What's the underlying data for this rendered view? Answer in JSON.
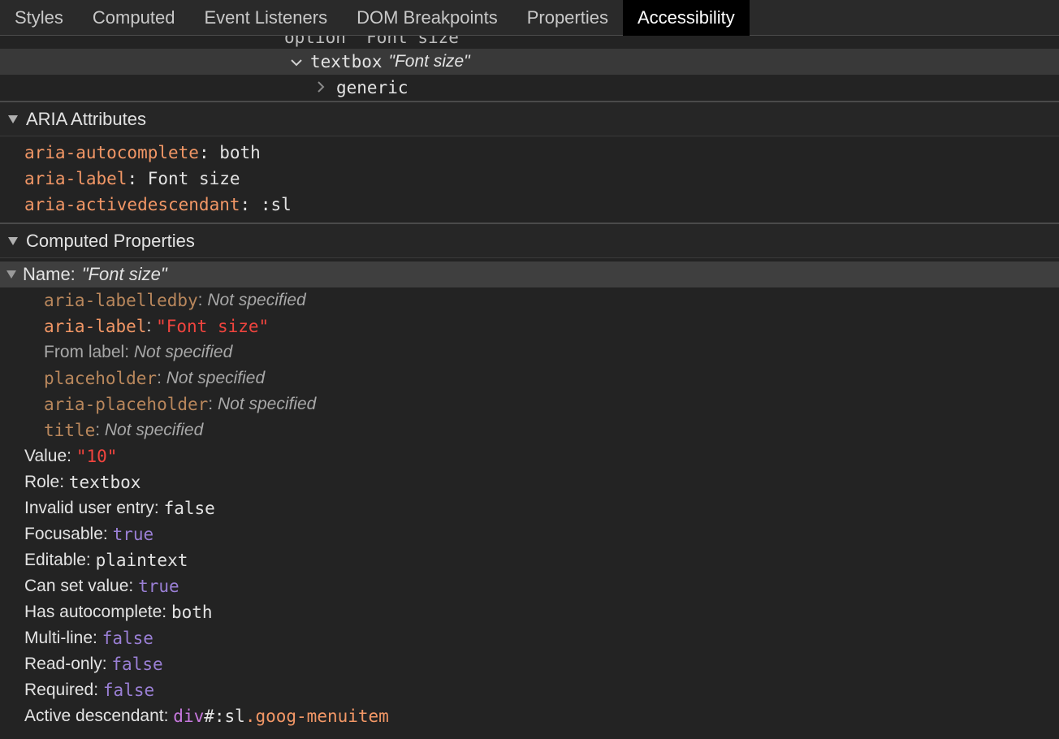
{
  "tabs": [
    "Styles",
    "Computed",
    "Event Listeners",
    "DOM Breakpoints",
    "Properties",
    "Accessibility"
  ],
  "tree": {
    "clipped_row": "option \"Font size\"",
    "selected": {
      "role": "textbox",
      "name": "\"Font size\""
    },
    "child": "generic"
  },
  "aria_section": {
    "title": "ARIA Attributes",
    "attrs": [
      {
        "name": "aria-autocomplete",
        "value": "both"
      },
      {
        "name": "aria-label",
        "value": "Font size"
      },
      {
        "name": "aria-activedescendant",
        "value": ":sl"
      }
    ]
  },
  "computed_section": {
    "title": "Computed Properties",
    "name_label": "Name:",
    "name_value": "\"Font size\"",
    "sources": [
      {
        "name": "aria-labelledby",
        "value": "Not specified"
      },
      {
        "name": "aria-label",
        "value": "\"Font size\""
      },
      {
        "name": "From label",
        "value": "Not specified"
      },
      {
        "name": "placeholder",
        "value": "Not specified"
      },
      {
        "name": "aria-placeholder",
        "value": "Not specified"
      },
      {
        "name": "title",
        "value": "Not specified"
      }
    ],
    "props": [
      {
        "label": "Value:",
        "value": "\"10\""
      },
      {
        "label": "Role:",
        "value": "textbox"
      },
      {
        "label": "Invalid user entry:",
        "value": "false"
      },
      {
        "label": "Focusable:",
        "value": "true"
      },
      {
        "label": "Editable:",
        "value": "plaintext"
      },
      {
        "label": "Can set value:",
        "value": "true"
      },
      {
        "label": "Has autocomplete:",
        "value": "both"
      },
      {
        "label": "Multi-line:",
        "value": "false"
      },
      {
        "label": "Read-only:",
        "value": "false"
      },
      {
        "label": "Required:",
        "value": "false"
      }
    ],
    "active_descendant": {
      "label": "Active descendant:",
      "tag": "div",
      "id": "#:sl",
      "cls": ".goog-menuitem"
    }
  }
}
